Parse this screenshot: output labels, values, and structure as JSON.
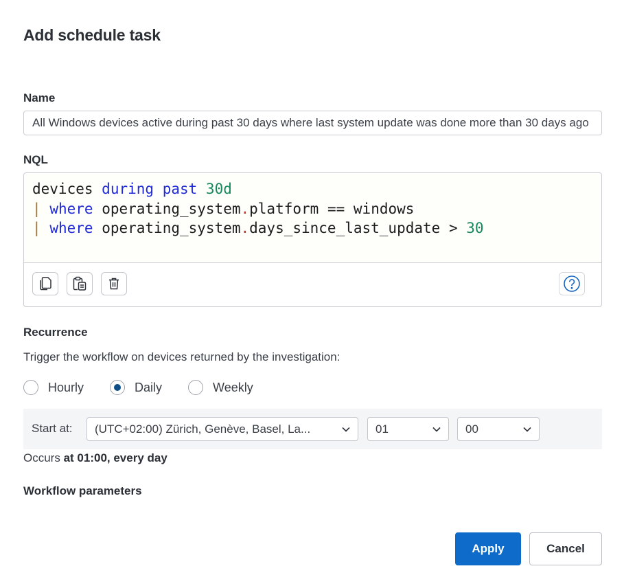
{
  "dialog": {
    "title": "Add schedule task"
  },
  "name": {
    "label": "Name",
    "value": "All Windows devices active during past 30 days where last system update was done more than 30 days ago"
  },
  "nql": {
    "label": "NQL",
    "lines": [
      {
        "pipe": "",
        "t1": "devices",
        "kw1": "during",
        "t2": "",
        "kw2": "past",
        "num": "30d",
        "rest": ""
      },
      {
        "pipe": "|",
        "kw1": "where",
        "obj": "operating_system",
        "dot": ".",
        "field": "platform",
        "op": "==",
        "val": "windows"
      },
      {
        "pipe": "|",
        "kw1": "where",
        "obj": "operating_system",
        "dot": ".",
        "field": "days_since_last_update",
        "op": ">",
        "num": "30"
      }
    ],
    "toolbar": {
      "copy_icon": "copy-icon",
      "paste_icon": "paste-icon",
      "delete_icon": "trash-icon",
      "help_icon": "help-icon"
    }
  },
  "recurrence": {
    "label": "Recurrence",
    "description": "Trigger the workflow on devices returned by the investigation:",
    "options": [
      "Hourly",
      "Daily",
      "Weekly"
    ],
    "selected": "Daily",
    "start_label": "Start at:",
    "timezone": "(UTC+02:00) Zürich, Genève, Basel, La...",
    "hour": "01",
    "minute": "00",
    "occurs_prefix": "Occurs",
    "occurs_value": "at 01:00, every day"
  },
  "workflow_parameters": {
    "label": "Workflow parameters"
  },
  "actions": {
    "apply": "Apply",
    "cancel": "Cancel"
  },
  "colors": {
    "primary": "#0f6bc9",
    "radio_checked": "#0e4f87",
    "keyword": "#1f2ad6",
    "number": "#168a5c"
  }
}
